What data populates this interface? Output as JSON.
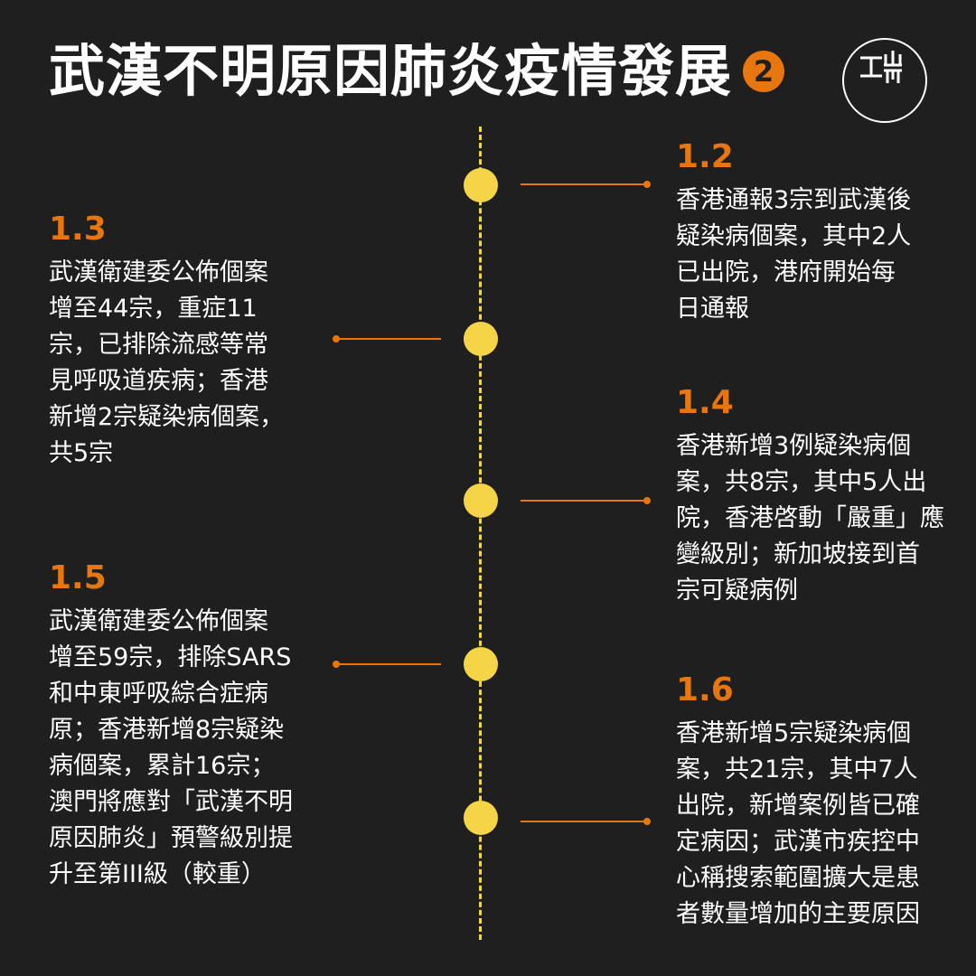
{
  "header": {
    "title": "武漢不明原因肺炎疫情發展",
    "part": "2"
  },
  "logo": {
    "icon": "initium-logo-icon"
  },
  "colors": {
    "background": "#1f1f1f",
    "accent": "#e8760f",
    "timeline": "#f5d547",
    "text": "#ffffff"
  },
  "events": [
    {
      "date": "1.2",
      "text": "香港通報3宗到武漢後\n疑染病個案，其中2人\n已出院，港府開始每\n日通報"
    },
    {
      "date": "1.3",
      "text": "武漢衛建委公佈個案\n增至44宗，重症11\n宗，已排除流感等常\n見呼吸道疾病；香港\n新增2宗疑染病個案，\n共5宗"
    },
    {
      "date": "1.4",
      "text": "香港新增3例疑染病個\n案，共8宗，其中5人出\n院，香港啓動「嚴重」應\n變級別；新加坡接到首\n宗可疑病例"
    },
    {
      "date": "1.5",
      "text": "武漢衛建委公佈個案\n增至59宗，排除SARS\n和中東呼吸綜合症病\n原；香港新增8宗疑染\n病個案，累計16宗；\n澳門將應對「武漢不明\n原因肺炎」預警級別提\n升至第III級（較重）"
    },
    {
      "date": "1.6",
      "text": "香港新增5宗疑染病個\n案，共21宗，其中7人\n出院，新增案例皆已確\n定病因；武漢市疾控中\n心稱搜索範圍擴大是患\n者數量增加的主要原因"
    }
  ]
}
